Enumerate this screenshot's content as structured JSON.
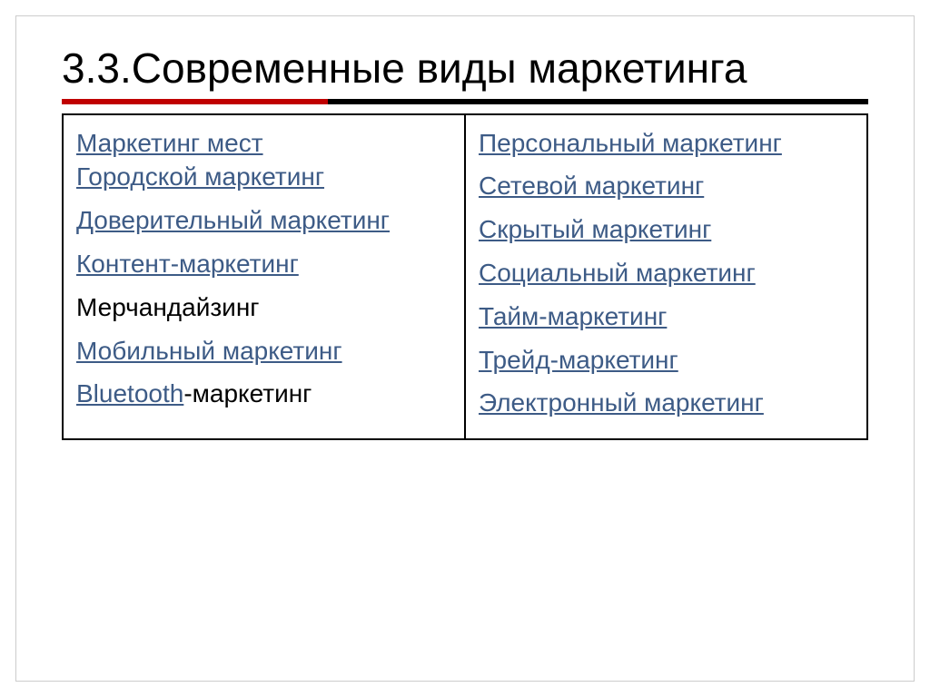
{
  "title": "3.3.Современные виды маркетинга",
  "left": {
    "items": [
      {
        "parts": [
          {
            "text": "Маркетинг мест",
            "style": "link"
          }
        ]
      },
      {
        "parts": [
          {
            "text": "Городской маркетинг",
            "style": "link"
          }
        ],
        "tight": true
      },
      {
        "parts": [
          {
            "text": "Доверительный маркетинг",
            "style": "link"
          }
        ]
      },
      {
        "parts": [
          {
            "text": "Контент-маркетинг",
            "style": "link"
          }
        ]
      },
      {
        "parts": [
          {
            "text": "Мерчандайзинг",
            "style": "plain"
          }
        ]
      },
      {
        "parts": [
          {
            "text": "Мобильный маркетинг",
            "style": "link"
          }
        ]
      },
      {
        "parts": [
          {
            "text": "Bluetooth",
            "style": "partial-link"
          },
          {
            "text": "-маркетинг",
            "style": "partial-rest"
          }
        ]
      }
    ]
  },
  "right": {
    "items": [
      {
        "parts": [
          {
            "text": "Персональный маркетинг",
            "style": "link"
          }
        ]
      },
      {
        "parts": [
          {
            "text": "Сетевой маркетинг",
            "style": "link"
          }
        ]
      },
      {
        "parts": [
          {
            "text": "Скрытый маркетинг",
            "style": "link"
          }
        ]
      },
      {
        "parts": [
          {
            "text": "Социальный маркетинг",
            "style": "link"
          }
        ]
      },
      {
        "parts": [
          {
            "text": "Тайм-маркетинг",
            "style": "link"
          }
        ]
      },
      {
        "parts": [
          {
            "text": "Трейд-маркетинг",
            "style": "link"
          }
        ]
      },
      {
        "parts": [
          {
            "text": "Электронный маркетинг",
            "style": "link"
          }
        ]
      }
    ]
  }
}
